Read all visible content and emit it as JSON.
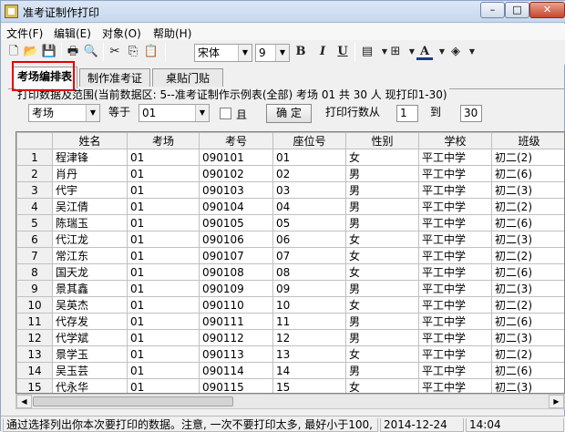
{
  "window": {
    "title": "准考证制作打印",
    "min": "–",
    "max": "□",
    "close": "✕"
  },
  "menu": [
    "文件(F)",
    "编辑(E)",
    "对象(O)",
    "帮助(H)"
  ],
  "toolbar": {
    "icons": [
      "new-file-icon",
      "open-folder-icon",
      "save-icon",
      "print-icon",
      "print-preview-icon",
      "cut-icon",
      "copy-icon",
      "paste-icon"
    ],
    "font_name": "宋体",
    "font_size": "9",
    "bold": "B",
    "italic": "I",
    "underline": "U",
    "text_color": "A"
  },
  "tabs": [
    "考场编排表",
    "制作准考证",
    "桌贴门贴"
  ],
  "filter": {
    "info": "打印数据及范围(当前数据区: 5--准考证制作示例表(全部)   考场 01 共 30 人 现打印1-30)",
    "field": "考场",
    "op": "等于",
    "value": "01",
    "and_label": "且",
    "confirm": "确 定",
    "range_label": "打印行数从",
    "from": "1",
    "to_label": "到",
    "to": "30"
  },
  "grid": {
    "columns": [
      "姓名",
      "考场",
      "考号",
      "座位号",
      "性别",
      "学校",
      "班级"
    ],
    "rows": [
      [
        "1",
        "程津锋",
        "01",
        "090101",
        "01",
        "女",
        "平工中学",
        "初二(2)"
      ],
      [
        "2",
        "肖丹",
        "01",
        "090102",
        "02",
        "男",
        "平工中学",
        "初二(6)"
      ],
      [
        "3",
        "代宇",
        "01",
        "090103",
        "03",
        "男",
        "平工中学",
        "初二(3)"
      ],
      [
        "4",
        "吴江倩",
        "01",
        "090104",
        "04",
        "男",
        "平工中学",
        "初二(2)"
      ],
      [
        "5",
        "陈瑞玉",
        "01",
        "090105",
        "05",
        "男",
        "平工中学",
        "初二(6)"
      ],
      [
        "6",
        "代江龙",
        "01",
        "090106",
        "06",
        "女",
        "平工中学",
        "初二(3)"
      ],
      [
        "7",
        "常江东",
        "01",
        "090107",
        "07",
        "女",
        "平工中学",
        "初二(2)"
      ],
      [
        "8",
        "国天龙",
        "01",
        "090108",
        "08",
        "女",
        "平工中学",
        "初二(6)"
      ],
      [
        "9",
        "景其鑫",
        "01",
        "090109",
        "09",
        "男",
        "平工中学",
        "初二(3)"
      ],
      [
        "10",
        "吴英杰",
        "01",
        "090110",
        "10",
        "女",
        "平工中学",
        "初二(2)"
      ],
      [
        "11",
        "代存发",
        "01",
        "090111",
        "11",
        "男",
        "平工中学",
        "初二(6)"
      ],
      [
        "12",
        "代学斌",
        "01",
        "090112",
        "12",
        "男",
        "平工中学",
        "初二(3)"
      ],
      [
        "13",
        "景学玉",
        "01",
        "090113",
        "13",
        "女",
        "平工中学",
        "初二(2)"
      ],
      [
        "14",
        "吴玉芸",
        "01",
        "090114",
        "14",
        "男",
        "平工中学",
        "初二(6)"
      ],
      [
        "15",
        "代永华",
        "01",
        "090115",
        "15",
        "女",
        "平工中学",
        "初二(3)"
      ]
    ]
  },
  "status": {
    "message": "通过选择列出你本次要打印的数据。注意, 一次不要打印太多, 最好小于100,",
    "date": "2014-12-24",
    "time": "14:04"
  }
}
